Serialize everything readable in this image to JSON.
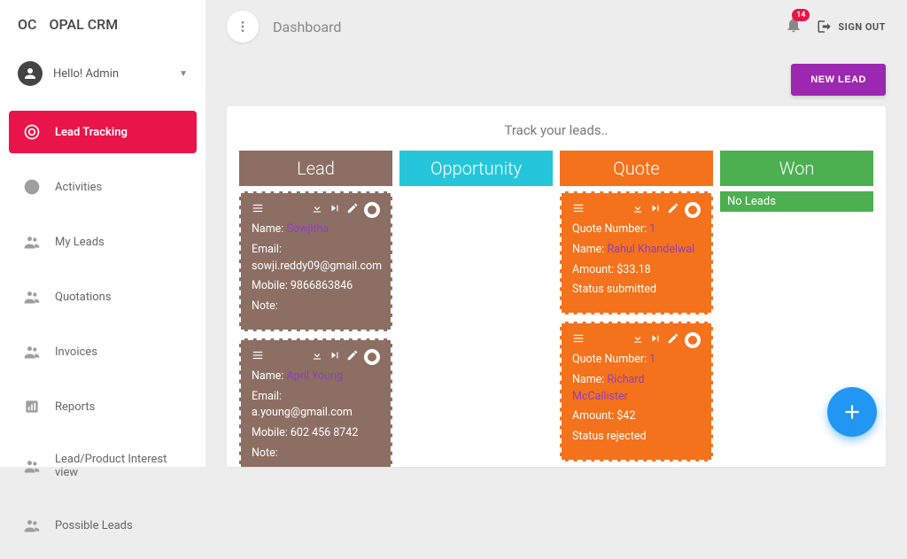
{
  "brand": {
    "badge": "OC",
    "name": "OPAL CRM"
  },
  "user": {
    "greeting": "Hello! Admin"
  },
  "nav": [
    {
      "key": "lead-tracking",
      "label": "Lead Tracking",
      "active": true
    },
    {
      "key": "activities",
      "label": "Activities"
    },
    {
      "key": "my-leads",
      "label": "My Leads"
    },
    {
      "key": "quotations",
      "label": "Quotations"
    },
    {
      "key": "invoices",
      "label": "Invoices"
    },
    {
      "key": "reports",
      "label": "Reports"
    },
    {
      "key": "lead-product-interest",
      "label": "Lead/Product Interest view"
    },
    {
      "key": "possible-leads",
      "label": "Possible Leads"
    }
  ],
  "topbar": {
    "title": "Dashboard",
    "notifications": "14",
    "signout": "SIGN OUT"
  },
  "actions": {
    "new_lead": "NEW LEAD"
  },
  "board": {
    "title": "Track your leads..",
    "columns": {
      "lead": "Lead",
      "opportunity": "Opportunity",
      "quote": "Quote",
      "won": "Won"
    },
    "won_empty": "No Leads",
    "labels": {
      "name": "Name:",
      "email": "Email:",
      "mobile": "Mobile:",
      "note": "Note:",
      "quote_number": "Quote Number:",
      "amount": "Amount:",
      "status": "Status"
    },
    "leads": [
      {
        "name": "Sowjitha",
        "email": "sowji.reddy09@gmail.com",
        "mobile": "9866863846",
        "note": ""
      },
      {
        "name": "April Young",
        "email": "a.young@gmail.com",
        "mobile": "602 456 8742",
        "note": ""
      }
    ],
    "quotes": [
      {
        "number": "1",
        "name": "Rahul Khandelwal",
        "amount": "$33.18",
        "status": "submitted"
      },
      {
        "number": "1",
        "name": "Richard McCallister",
        "amount": "$42",
        "status": "rejected"
      }
    ]
  }
}
